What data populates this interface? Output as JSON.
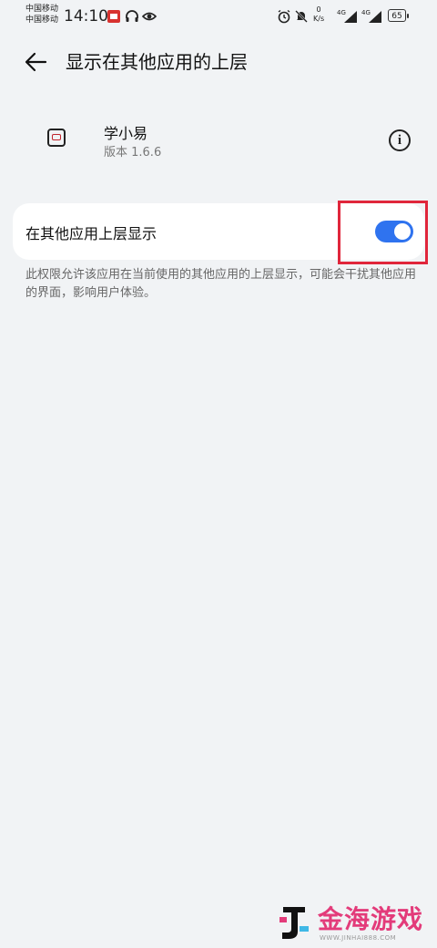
{
  "status_bar": {
    "carrier_1": "中国移动",
    "carrier_2": "中国移动",
    "time": "14:10",
    "net_speed_value": "0",
    "net_speed_unit": "K/s",
    "signal_1": "4G",
    "signal_2": "4G",
    "battery": "65"
  },
  "header": {
    "title": "显示在其他应用的上层"
  },
  "app": {
    "name": "学小易",
    "version": "版本 1.6.6"
  },
  "setting": {
    "label": "在其他应用上层显示",
    "enabled": true,
    "accent_color": "#2f73ef"
  },
  "description": "此权限允许该应用在当前使用的其他应用的上层显示，可能会干扰其他应用的界面，影响用户体验。",
  "watermark": {
    "title": "金海游戏",
    "subtitle": "WWW.JINHAI888.COM"
  }
}
